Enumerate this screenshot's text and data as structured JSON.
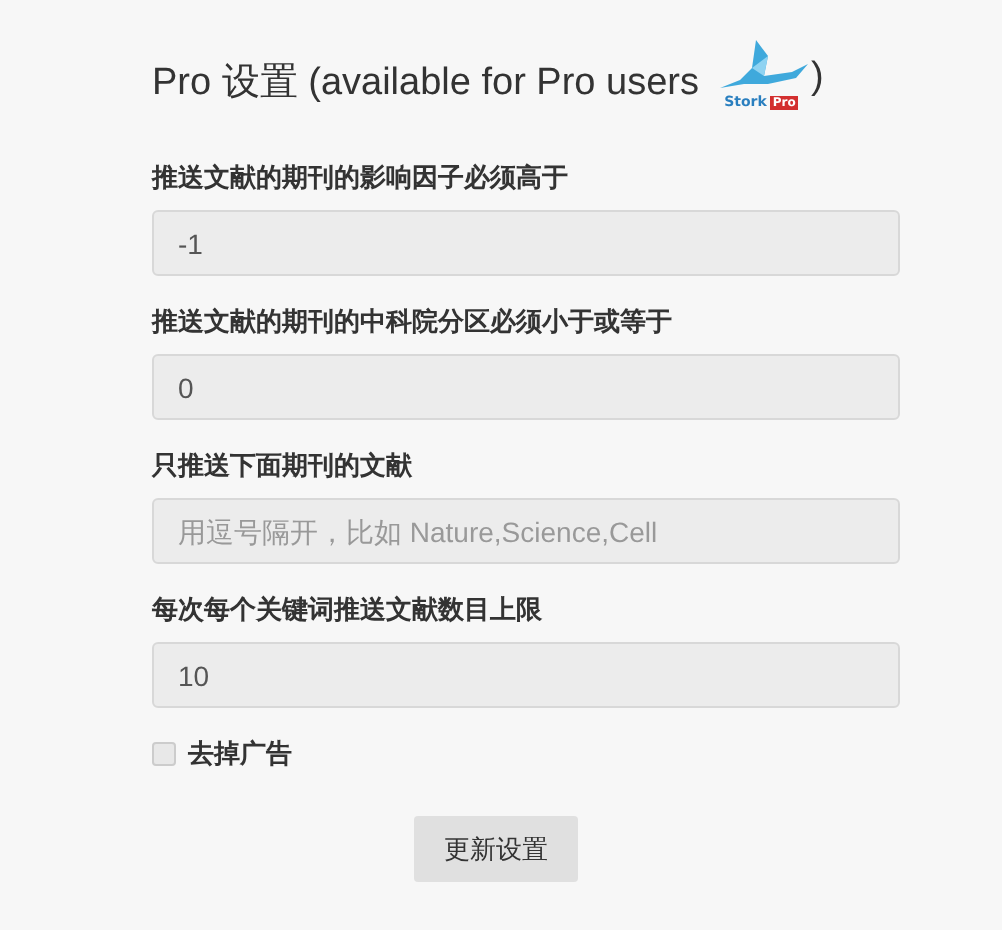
{
  "title": {
    "text": "Pro 设置 (available for Pro users",
    "close": ")",
    "logo": {
      "name": "Stork",
      "badge": "Pro"
    }
  },
  "fields": [
    {
      "label": "推送文献的期刊的影响因子必须高于",
      "value": "-1"
    },
    {
      "label": "推送文献的期刊的中科院分区必须小于或等于",
      "value": "0"
    },
    {
      "label": "只推送下面期刊的文献",
      "placeholder": "用逗号隔开，比如 Nature,Science,Cell"
    },
    {
      "label": "每次每个关键词推送文献数目上限",
      "value": "10"
    }
  ],
  "checkbox": {
    "label": "去掉广告",
    "checked": false
  },
  "button": "更新设置"
}
